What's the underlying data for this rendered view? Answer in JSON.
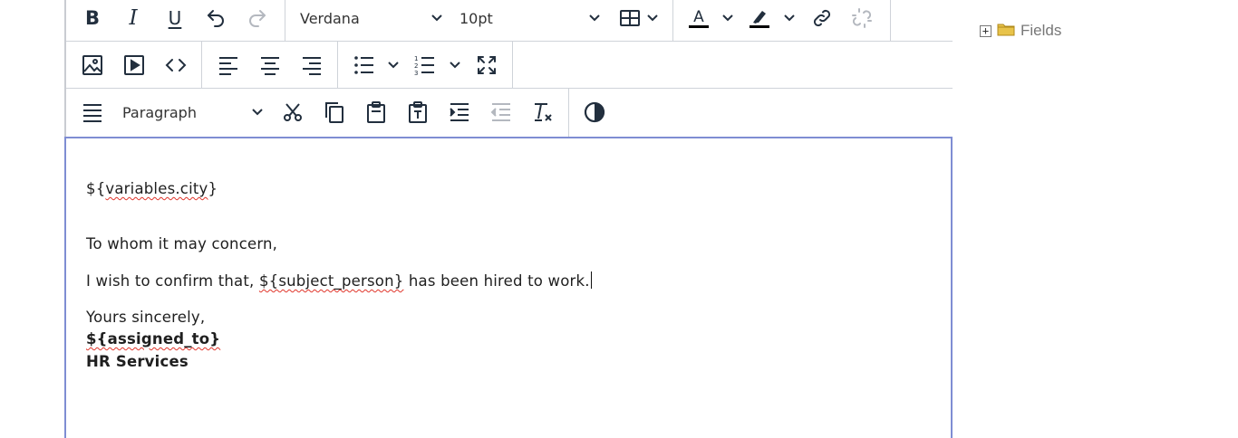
{
  "toolbar": {
    "font_family": "Verdana",
    "font_size": "10pt",
    "block_format": "Paragraph",
    "icons": {
      "bold": "bold-icon",
      "italic": "italic-icon",
      "underline": "underline-icon",
      "undo": "undo-icon",
      "redo": "redo-icon",
      "table": "table-icon",
      "text_color": "text-color-icon",
      "highlight": "highlight-icon",
      "link": "link-icon",
      "unlink": "unlink-icon",
      "image": "image-icon",
      "media": "media-icon",
      "code": "code-icon",
      "align_left": "align-left-icon",
      "align_center": "align-center-icon",
      "align_right": "align-right-icon",
      "bullet_list": "bullet-list-icon",
      "numbered_list": "numbered-list-icon",
      "fullscreen": "fullscreen-icon",
      "justify": "justify-icon",
      "cut": "cut-icon",
      "copy": "copy-icon",
      "paste": "paste-icon",
      "paste_text": "paste-text-icon",
      "indent": "indent-icon",
      "outdent": "outdent-icon",
      "clear_format": "clear-format-icon",
      "contrast": "contrast-icon"
    },
    "colors": {
      "icon": "#222f3e",
      "disabled": "#b4b8bf",
      "text_color_bar": "#000000",
      "highlight_bar": "#000000"
    }
  },
  "content": {
    "city": "${variables.city}",
    "greeting": "To whom it may concern,",
    "body_before": "I wish to confirm that, ",
    "body_var": "${subject_person}",
    "body_after": " has been hired to work.",
    "closing": "Yours sincerely,",
    "assigned": "${assigned_to}",
    "department": "HR Services"
  },
  "sidebar": {
    "expander": "+",
    "folder_icon": "folder-icon",
    "label": "Fields",
    "folder_color": "#e8c34a"
  },
  "colors": {
    "focus_border": "#7f8dd3",
    "spellcheck": "#e0352b"
  }
}
